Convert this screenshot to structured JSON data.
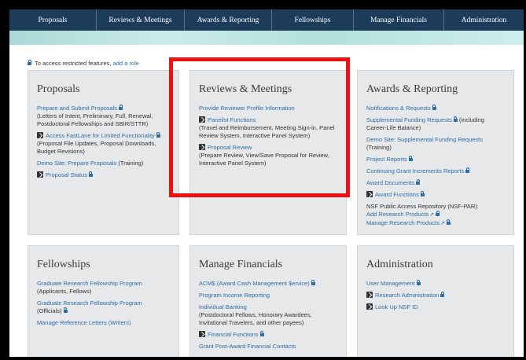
{
  "nav": {
    "items": [
      {
        "label": "Proposals"
      },
      {
        "label": "Reviews & Meetings"
      },
      {
        "label": "Awards & Reporting"
      },
      {
        "label": "Fellowships"
      },
      {
        "label": "Manage Financials"
      },
      {
        "label": "Administration"
      }
    ]
  },
  "notice": {
    "text": "To access restricted features,",
    "link": "add a role"
  },
  "cards": {
    "proposals": {
      "title": "Proposals",
      "link1": "Prepare and Submit Proposals",
      "desc1": "(Letters of Intent, Preliminary, Full, Renewal, Postdoctoral Fellowships and SBIR/STTR)",
      "link2": "Access FastLane for Limited Functionality",
      "desc2": "(Proposal File Updates, Proposal Downloads, Budget Revisions)",
      "link3": "Demo Site: Prepare Proposals",
      "desc3": "(Training)",
      "link4": "Proposal Status"
    },
    "reviews": {
      "title": "Reviews & Meetings",
      "link1": "Provide Reviewer Profile Information",
      "link2": "Panelist Functions",
      "desc2": "(Travel and Reimbursement, Meeting Sign-in, Panel Review System, Interactive Panel System)",
      "link3": "Proposal Review",
      "desc3": "(Prepare Review, View/Save Proposal for Review, Interactive Panel System)"
    },
    "awards": {
      "title": "Awards & Reporting",
      "link1": "Notifications & Requests",
      "link2": "Supplemental Funding Requests",
      "desc2": "(including Career-Life Balance)",
      "link3": "Demo Site: Supplemental Funding Requests",
      "desc3": "(Training)",
      "link4": "Project Reports",
      "link5": "Continuing Grant Increments Reports",
      "link6": "Award Documents",
      "link7": "Award Functions",
      "desc8": "NSF Public Access Repository (NSF-PAR):",
      "link8": "Add Research Products",
      "link9": "Manage Research Products"
    },
    "fellowships": {
      "title": "Fellowships",
      "link1": "Graduate Research Fellowship Program",
      "desc1": "(Applicants, Fellows)",
      "link2": "Graduate Research Fellowship Program",
      "desc2": "(Officials)",
      "link3": "Manage Reference Letters (Writers)"
    },
    "financials": {
      "title": "Manage Financials",
      "link1": "ACM$ (Award Cash Management $ervice)",
      "link2": "Program Income Reporting",
      "link3": "Individual Banking",
      "desc3": "(Postdoctoral Fellows, Honorary Awardees, Invitational Travelers, and other payees)",
      "link4": "Financial Functions",
      "link5": "Grant Post-Award Financial Contacts"
    },
    "administration": {
      "title": "Administration",
      "link1": "User Management",
      "link2": "Research Administration",
      "link3": "Look Up NSF ID"
    }
  },
  "colors": {
    "navbar": "#1d3c5a",
    "link": "#2e6da4",
    "card_bg": "#e6e8ea",
    "highlight": "#ee1111"
  }
}
